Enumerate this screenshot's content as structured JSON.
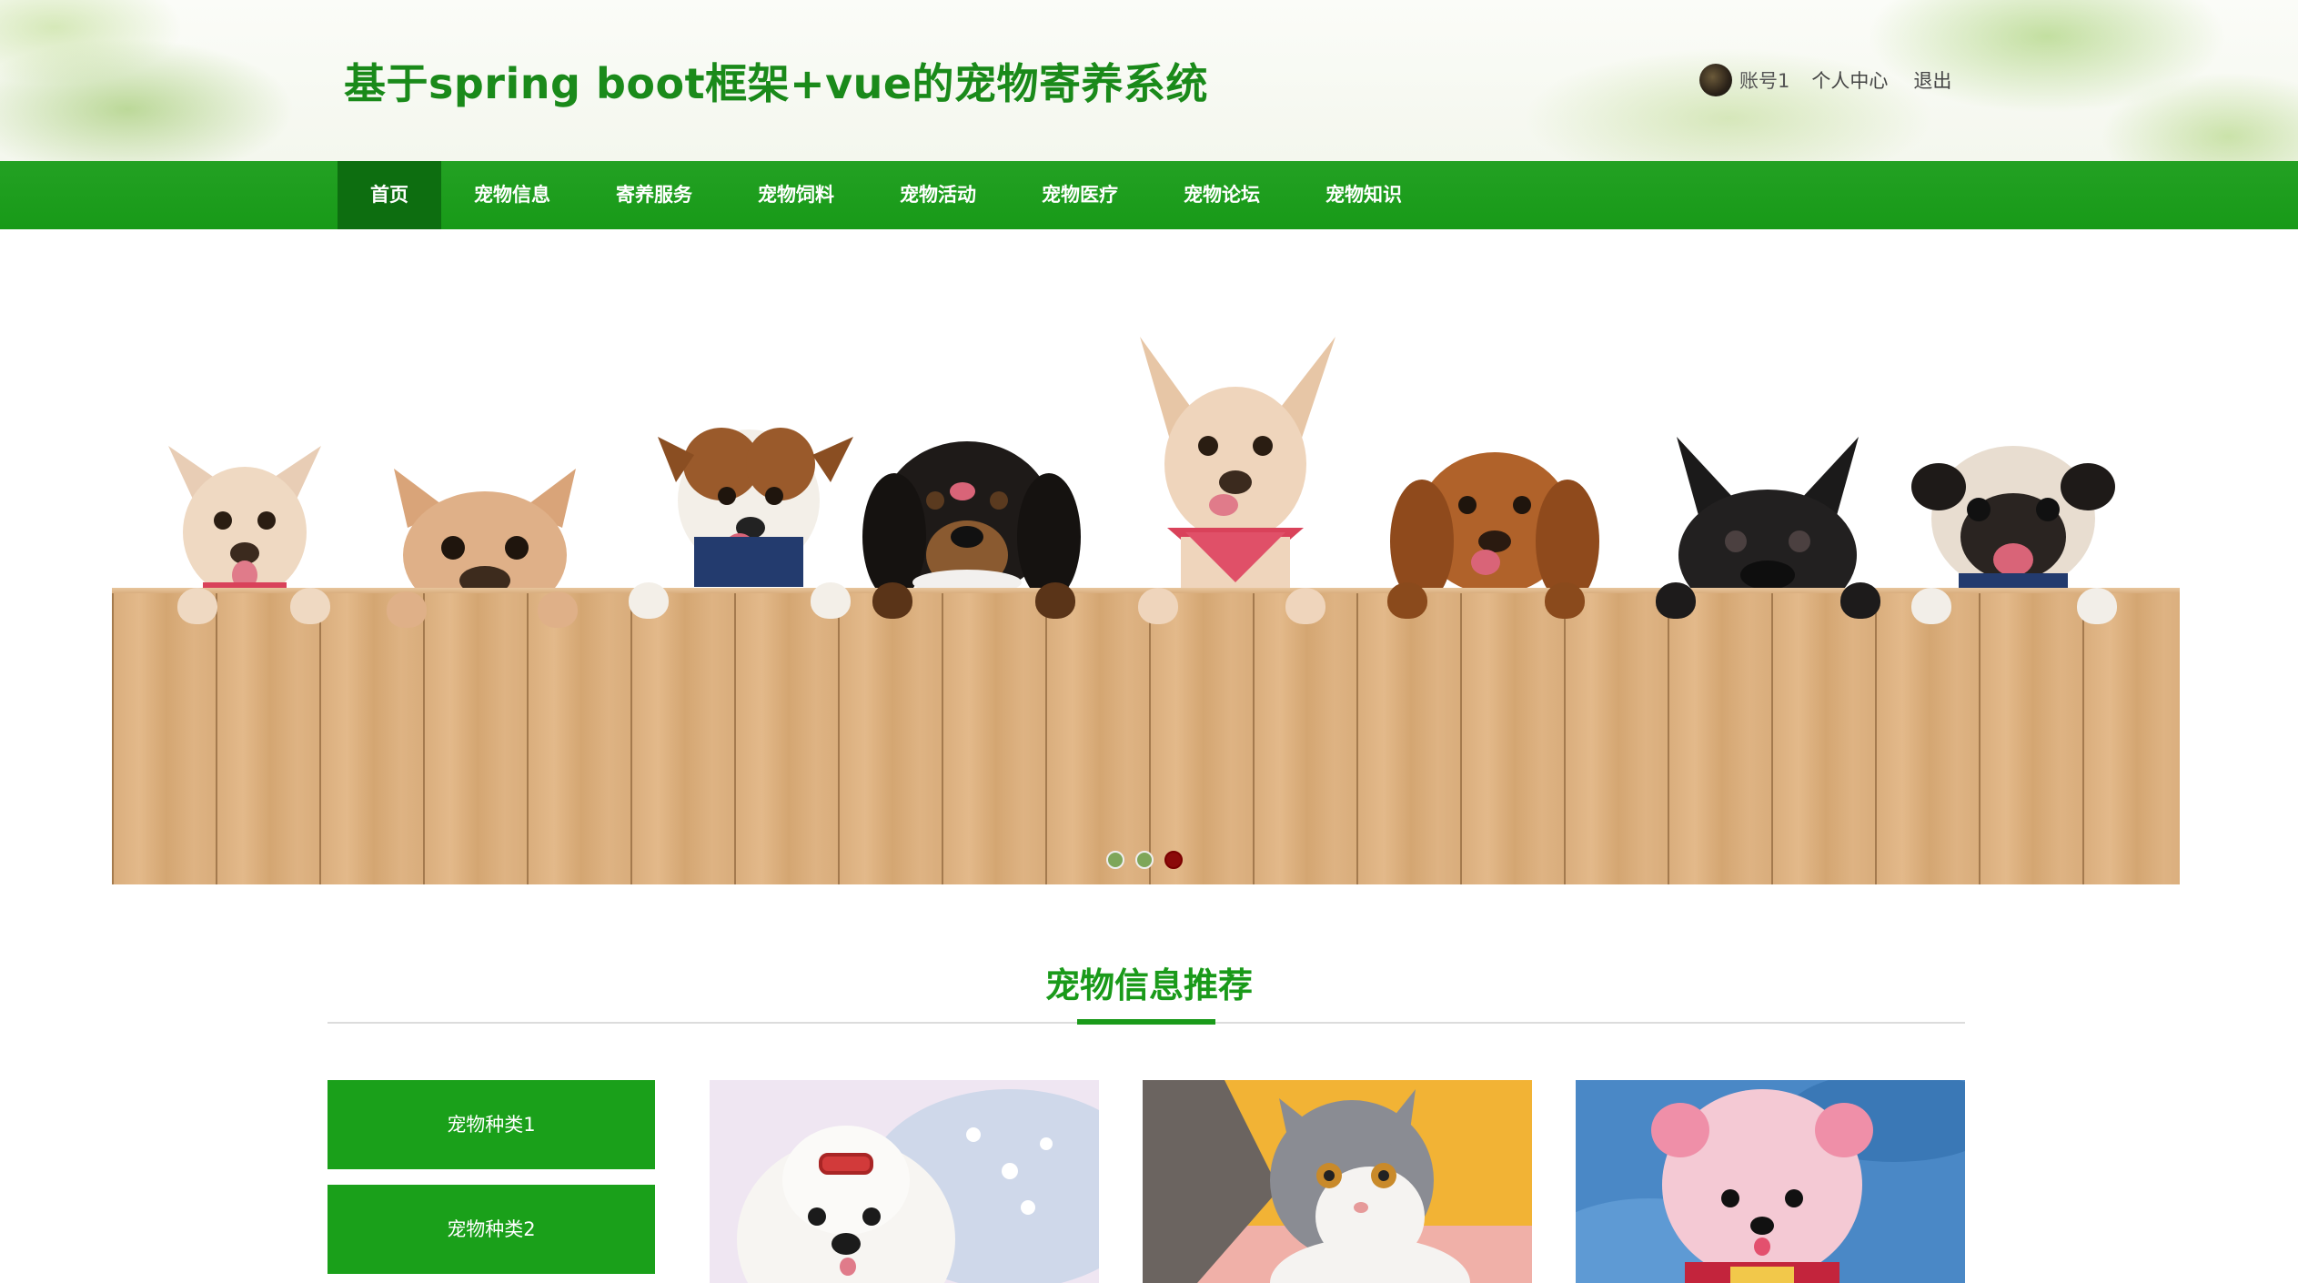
{
  "header": {
    "site_title": "基于spring boot框架+vue的宠物寄养系统",
    "user": {
      "account_label": "账号1",
      "profile_link": "个人中心",
      "logout_link": "退出"
    }
  },
  "nav": {
    "items": [
      {
        "label": "首页",
        "active": true
      },
      {
        "label": "宠物信息"
      },
      {
        "label": "寄养服务"
      },
      {
        "label": "宠物饲料"
      },
      {
        "label": "宠物活动"
      },
      {
        "label": "宠物医疗"
      },
      {
        "label": "宠物论坛"
      },
      {
        "label": "宠物知识"
      }
    ]
  },
  "banner": {
    "slide_count": 3,
    "active_slide": 3
  },
  "recommend": {
    "title": "宠物信息推荐",
    "categories": [
      "宠物种类1",
      "宠物种类2"
    ],
    "cards": [
      {
        "image": "white-maltese-dog"
      },
      {
        "image": "grey-white-kitten"
      },
      {
        "image": "pink-pomeranian"
      }
    ]
  },
  "colors": {
    "brand_green": "#1a9a1a",
    "nav_active": "#0d6e10",
    "dot_active": "#8b0a0a"
  }
}
